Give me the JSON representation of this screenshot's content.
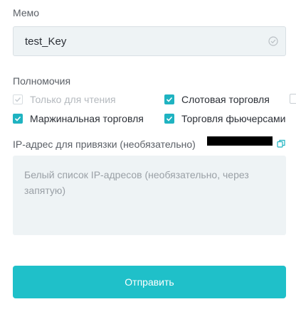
{
  "memo": {
    "label": "Мемо",
    "value": "test_Key"
  },
  "permissions": {
    "label": "Полномочия",
    "items": [
      {
        "label": "Только для чтения",
        "checked": true,
        "disabled": true
      },
      {
        "label": "Слотовая торговля",
        "checked": true,
        "disabled": false
      },
      {
        "label": "",
        "checked": false,
        "disabled": false
      },
      {
        "label": "Маржинальная торговля",
        "checked": true,
        "disabled": false
      },
      {
        "label": "Торговля фьючерсами",
        "checked": true,
        "disabled": false
      }
    ]
  },
  "ip_binding": {
    "label": "IP-адрес для привязки (необязательно)",
    "placeholder": "Белый список IP-адресов (необязательно, через запятую)"
  },
  "submit": {
    "label": "Отправить"
  },
  "colors": {
    "accent": "#1fc0c9",
    "checkbox": "#1fb3c1",
    "field_bg": "#eef3f5"
  },
  "icons": [
    "check-circle-icon",
    "checkbox-checked-icon",
    "copy-icon"
  ]
}
